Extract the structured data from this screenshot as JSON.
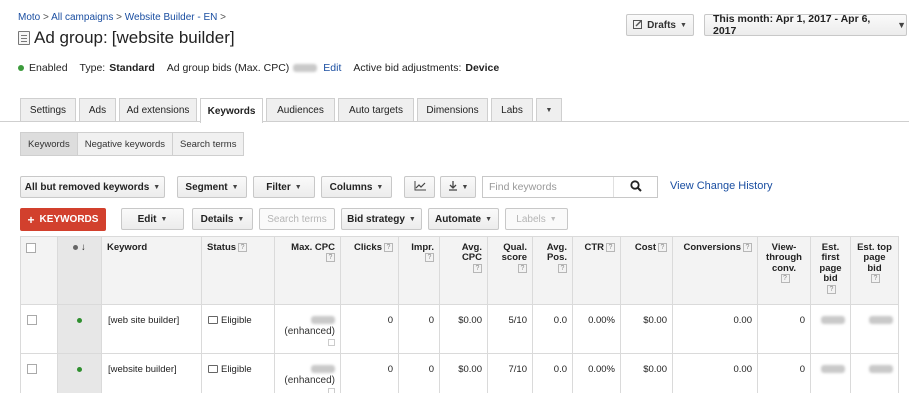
{
  "breadcrumb": {
    "item1": "Moto",
    "sep1": " > ",
    "item2": "All campaigns",
    "sep2": " > ",
    "item3": "Website Builder - EN",
    "sep3": " >"
  },
  "title": {
    "label": "Ad group:",
    "name": "[website builder]"
  },
  "header": {
    "drafts": "Drafts",
    "date_range": "This month: Apr 1, 2017 - Apr 6, 2017"
  },
  "summary": {
    "status": "Enabled",
    "type_label": "Type:",
    "type_value": "Standard",
    "bids_label": "Ad group bids (Max. CPC)",
    "edit": "Edit",
    "adjust_label": "Active bid adjustments:",
    "adjust_value": "Device"
  },
  "tabs": [
    "Settings",
    "Ads",
    "Ad extensions",
    "Keywords",
    "Audiences",
    "Auto targets",
    "Dimensions",
    "Labs"
  ],
  "subtabs": [
    "Keywords",
    "Negative keywords",
    "Search terms"
  ],
  "toolbar1": {
    "filter_view": "All but removed keywords",
    "segment": "Segment",
    "filter": "Filter",
    "columns": "Columns",
    "search_placeholder": "Find keywords",
    "view_history": "View Change History"
  },
  "toolbar2": {
    "add_keywords": "KEYWORDS",
    "edit": "Edit",
    "details": "Details",
    "search_terms": "Search terms",
    "bid_strategy": "Bid strategy",
    "automate": "Automate",
    "labels": "Labels"
  },
  "table": {
    "headers": {
      "keyword": "Keyword",
      "status": "Status",
      "max_cpc": "Max. CPC",
      "clicks": "Clicks",
      "impr": "Impr.",
      "avg_cpc": "Avg. CPC",
      "qual_score": "Qual. score",
      "avg_pos": "Avg. Pos.",
      "ctr": "CTR",
      "cost": "Cost",
      "conversions": "Conversions",
      "view_through": "View-through conv.",
      "est_first": "Est. first page bid",
      "est_top": "Est. top page bid"
    },
    "rows": [
      {
        "keyword": "[web site builder]",
        "status": "Eligible",
        "max_cpc_note": "(enhanced)",
        "clicks": "0",
        "impr": "0",
        "avg_cpc": "$0.00",
        "qual_score": "5/10",
        "avg_pos": "0.0",
        "ctr": "0.00%",
        "cost": "$0.00",
        "conversions": "0.00",
        "view_through": "0"
      },
      {
        "keyword": "[website builder]",
        "status": "Eligible",
        "max_cpc_note": "(enhanced)",
        "clicks": "0",
        "impr": "0",
        "avg_cpc": "$0.00",
        "qual_score": "7/10",
        "avg_pos": "0.0",
        "ctr": "0.00%",
        "cost": "$0.00",
        "conversions": "0.00",
        "view_through": "0"
      }
    ]
  },
  "colors": {
    "link": "#1a4ea1",
    "primary_button": "#d2402d",
    "enabled_dot": "#3c9b3c"
  }
}
